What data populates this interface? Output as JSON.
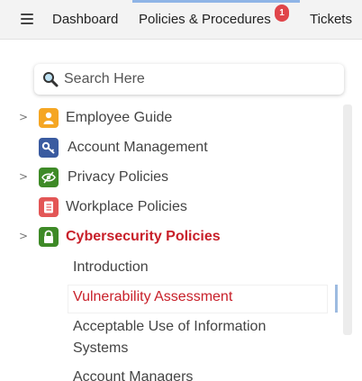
{
  "topnav": {
    "tabs": [
      {
        "label": "Dashboard"
      },
      {
        "label": "Policies & Procedures",
        "badge": "1",
        "active": true
      },
      {
        "label": "Tickets"
      }
    ]
  },
  "search": {
    "placeholder": "Search Here"
  },
  "tree": {
    "items": [
      {
        "label": "Employee Guide",
        "icon": "person-icon",
        "color": "#f5a623",
        "has_chevron": true
      },
      {
        "label": "Account Management",
        "icon": "key-icon",
        "color": "#3a5ba0",
        "has_chevron": false
      },
      {
        "label": "Privacy Policies",
        "icon": "eye-slash-icon",
        "color": "#3e8a27",
        "has_chevron": true
      },
      {
        "label": "Workplace Policies",
        "icon": "book-icon",
        "color": "#e35656",
        "has_chevron": false
      },
      {
        "label": "Cybersecurity Policies",
        "icon": "lock-icon",
        "color": "#3e8a27",
        "has_chevron": true,
        "active": true
      }
    ],
    "sub_items": [
      {
        "label": "Introduction"
      },
      {
        "label": "Vulnerability Assessment",
        "selected": true
      },
      {
        "label": "Acceptable Use of Information Systems"
      },
      {
        "label": "Account Managers"
      }
    ]
  },
  "colors": {
    "active_red": "#c8202a",
    "nav_accent": "#8fb4e6",
    "badge_red": "#e0454a"
  }
}
